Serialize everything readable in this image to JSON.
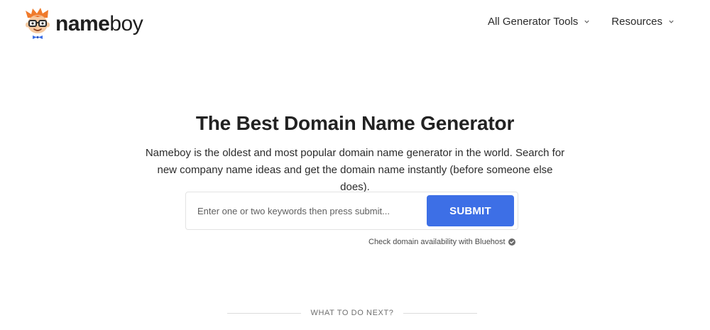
{
  "header": {
    "logo": {
      "text_bold": "name",
      "text_light": "boy",
      "icon": "nerd-mascot-icon"
    },
    "nav": [
      {
        "label": "All Generator Tools",
        "icon": "chevron-down-icon"
      },
      {
        "label": "Resources",
        "icon": "chevron-down-icon"
      }
    ]
  },
  "hero": {
    "title": "The Best Domain Name Generator",
    "description": "Nameboy is the oldest and most popular domain name generator in the world. Search for new company name ideas and get the domain name instantly (before someone else does)."
  },
  "search": {
    "value": "",
    "placeholder": "Enter one or two keywords then press submit...",
    "submit_label": "SUBMIT"
  },
  "bluehost_note": {
    "text": "Check domain availability with Bluehost",
    "icon": "check-circle-icon"
  },
  "next_section": {
    "label": "WHAT TO DO NEXT?"
  },
  "colors": {
    "accent": "#3d6fe6",
    "text": "#222222",
    "mascot_hair": "#f07a2b",
    "mascot_skin": "#f6c9a0"
  }
}
